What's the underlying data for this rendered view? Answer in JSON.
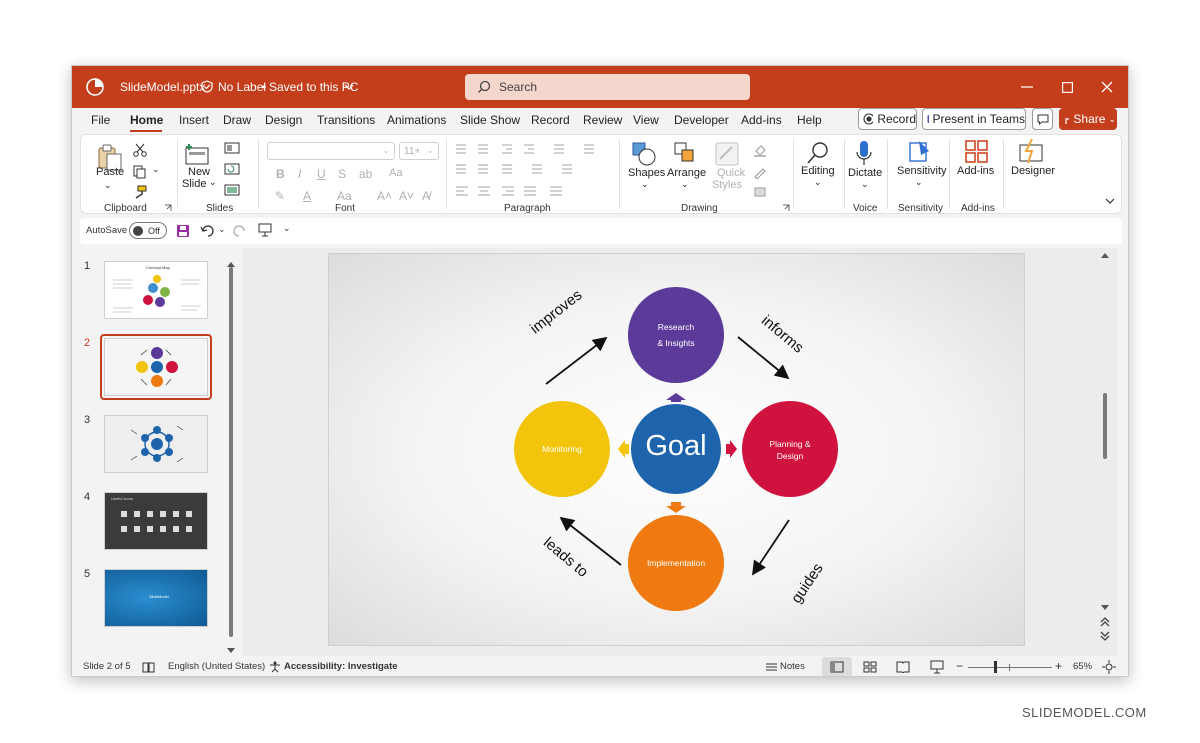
{
  "window": {
    "file_name": "SlideModel.pptx",
    "label_status": "No Label",
    "save_status": "Saved to this PC",
    "search_placeholder": "Search"
  },
  "tabs": [
    "File",
    "Home",
    "Insert",
    "Draw",
    "Design",
    "Transitions",
    "Animations",
    "Slide Show",
    "Record",
    "Review",
    "View",
    "Developer",
    "Add-ins",
    "Help"
  ],
  "active_tab": "Home",
  "top_actions": {
    "record": "Record",
    "present": "Present in Teams",
    "share": "Share"
  },
  "ribbon": {
    "clipboard": {
      "paste": "Paste",
      "group": "Clipboard"
    },
    "slides": {
      "new_slide_1": "New",
      "new_slide_2": "Slide",
      "group": "Slides"
    },
    "font": {
      "size": "11+",
      "group": "Font"
    },
    "paragraph": {
      "group": "Paragraph"
    },
    "drawing": {
      "shapes": "Shapes",
      "arrange": "Arrange",
      "quick_styles_1": "Quick",
      "quick_styles_2": "Styles",
      "group": "Drawing"
    },
    "editing": {
      "label": "Editing"
    },
    "voice": {
      "dictate": "Dictate",
      "group": "Voice"
    },
    "sensitivity": {
      "label": "Sensitivity",
      "group": "Sensitivity"
    },
    "addins": {
      "label": "Add-ins",
      "group": "Add-ins"
    },
    "designer": {
      "label": "Designer"
    }
  },
  "qat": {
    "autosave": "AutoSave",
    "toggle": "Off"
  },
  "thumbnails": [
    {
      "num": "1",
      "title": "Concept Map"
    },
    {
      "num": "2"
    },
    {
      "num": "3"
    },
    {
      "num": "4",
      "title": "Useful Icons"
    },
    {
      "num": "5",
      "title": "SlideModel"
    }
  ],
  "selected_slide": 2,
  "slide": {
    "center": "Goal",
    "top_1": "Research",
    "top_2": "& Insights",
    "right_1": "Planning &",
    "right_2": "Design",
    "bottom": "Implementation",
    "left": "Monitoring",
    "arrow_tl": "improves",
    "arrow_tr": "informs",
    "arrow_br": "guides",
    "arrow_bl": "leads to",
    "colors": {
      "goal": "#1e64ad",
      "research": "#5b3a9a",
      "planning": "#d0123e",
      "implementation": "#ef7a12",
      "monitoring": "#f2c40c"
    }
  },
  "status": {
    "slide_count": "Slide 2 of 5",
    "language": "English (United States)",
    "accessibility": "Accessibility: Investigate",
    "notes": "Notes",
    "zoom": "65%"
  },
  "brand": "SLIDEMODEL.COM"
}
